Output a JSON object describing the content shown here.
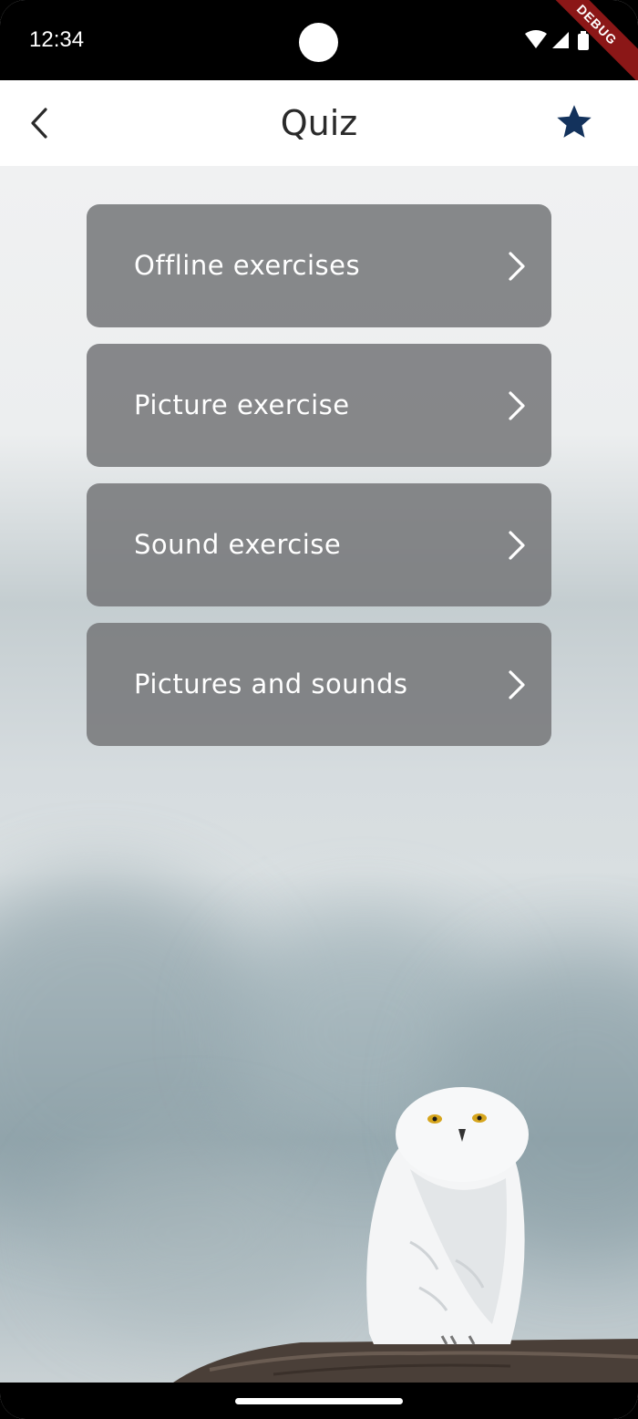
{
  "status_bar": {
    "time": "12:34",
    "icons": [
      "wifi-icon",
      "cellular-signal-icon",
      "battery-icon"
    ],
    "debug_banner": "DEBUG"
  },
  "app_bar": {
    "title": "Quiz",
    "back_icon": "chevron-left-icon",
    "favorite_icon": "star-icon",
    "star_color": "#13325c"
  },
  "menu": {
    "items": [
      {
        "label": "Offline exercises"
      },
      {
        "label": "Picture exercise"
      },
      {
        "label": "Sound exercise"
      },
      {
        "label": "Pictures and sounds"
      }
    ],
    "item_color": "#78797b",
    "chevron_icon": "chevron-right-icon"
  },
  "background": {
    "image": "snowy-owl-on-log"
  }
}
